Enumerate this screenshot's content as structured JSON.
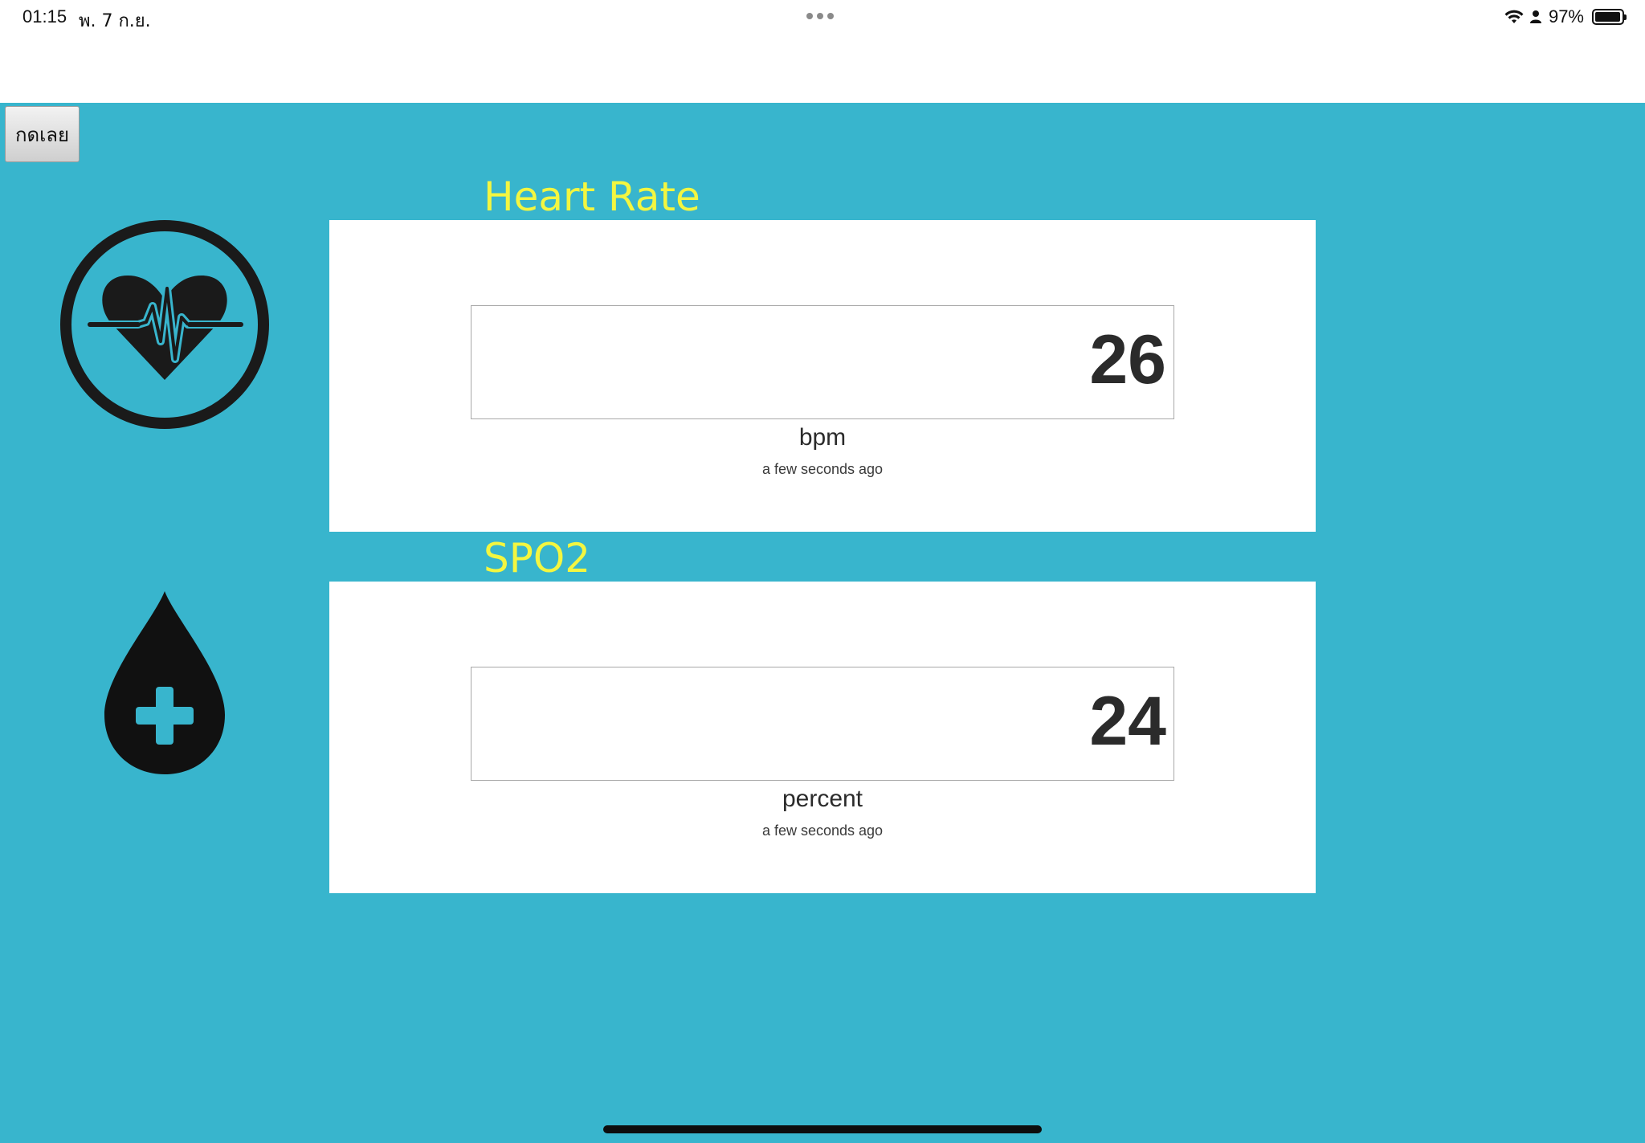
{
  "status_bar": {
    "time": "01:15",
    "date": "พ. 7 ก.ย.",
    "battery_percent": "97%",
    "battery_level": 0.97
  },
  "toolbar": {
    "button_label": "กดเลย"
  },
  "heart_rate": {
    "title": "Heart Rate",
    "value": "26",
    "unit": "bpm",
    "updated": "a few seconds ago"
  },
  "spo2": {
    "title": "SPO2",
    "value": "24",
    "unit": "percent",
    "updated": "a few seconds ago"
  },
  "colors": {
    "background": "#38b5cd",
    "title_yellow": "#f3f640",
    "card": "#ffffff",
    "icon": "#1a1a1a"
  },
  "icons": [
    "heart-pulse-icon",
    "blood-drop-plus-icon",
    "wifi-icon",
    "person-icon",
    "battery-icon"
  ]
}
